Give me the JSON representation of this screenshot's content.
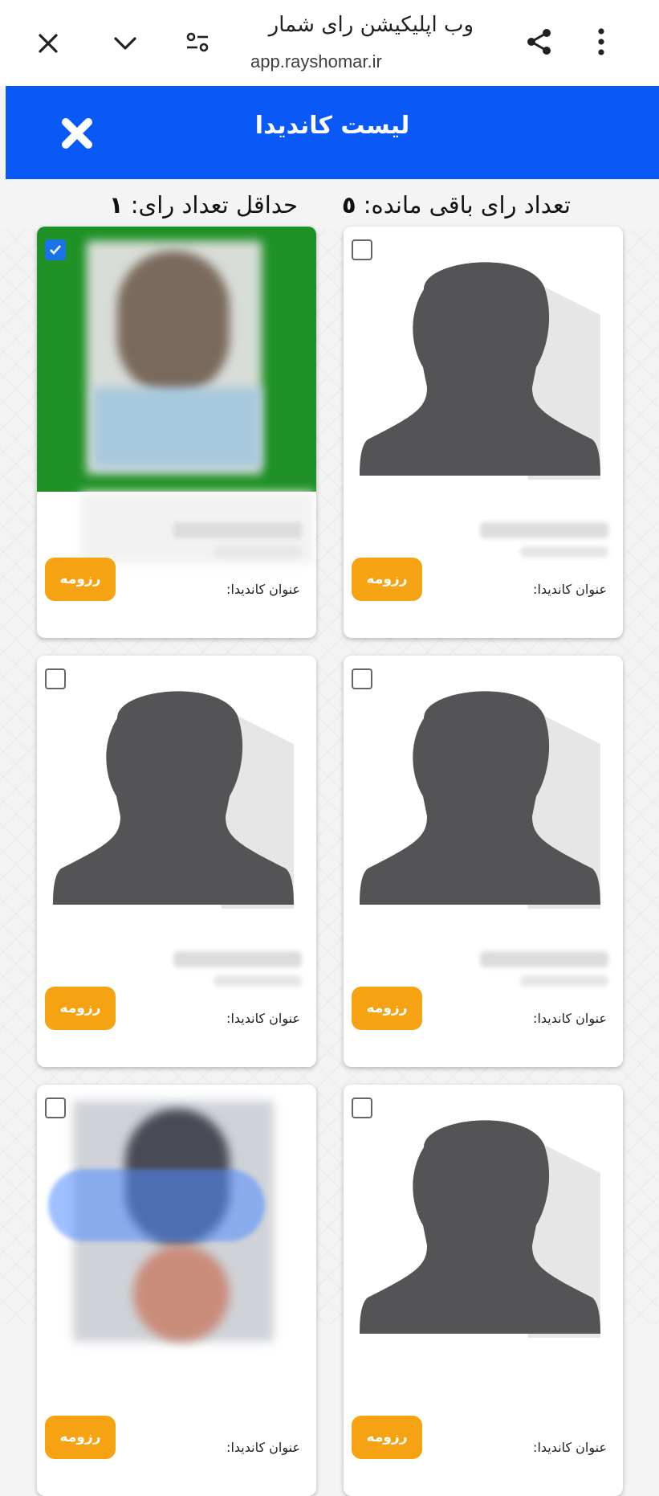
{
  "browser": {
    "page_title": "وب اپلیکیشن رای شمار",
    "host": "app.rayshomar.ir",
    "icons": [
      "close-icon",
      "chevron-down-icon",
      "tune-icon",
      "share-icon",
      "more-vert-icon"
    ]
  },
  "header": {
    "title": "لیست کاندیدا",
    "close_icon": "close-icon",
    "color": "#0a58f5"
  },
  "vote_info": {
    "remaining_label": "تعداد رای باقی مانده:",
    "remaining_value": "٥",
    "min_label": "حداقل تعداد رای:",
    "min_value": "١"
  },
  "candidates": [
    {
      "selected": false,
      "resume_label": "رزومه",
      "title_label": "عنوان کاندیدا:"
    },
    {
      "selected": true,
      "resume_label": "رزومه",
      "title_label": "عنوان کاندیدا:"
    },
    {
      "selected": false,
      "resume_label": "رزومه",
      "title_label": "عنوان کاندیدا:"
    },
    {
      "selected": false,
      "resume_label": "رزومه",
      "title_label": "عنوان کاندیدا:"
    },
    {
      "selected": false,
      "resume_label": "رزومه",
      "title_label": "عنوان کاندیدا:"
    },
    {
      "selected": false,
      "resume_label": "رزومه",
      "title_label": "عنوان کاندیدا:"
    }
  ],
  "colors": {
    "selected_bg": "#1f9126",
    "resume_button": "#f6a313",
    "checkbox_checked": "#1a73e8"
  }
}
